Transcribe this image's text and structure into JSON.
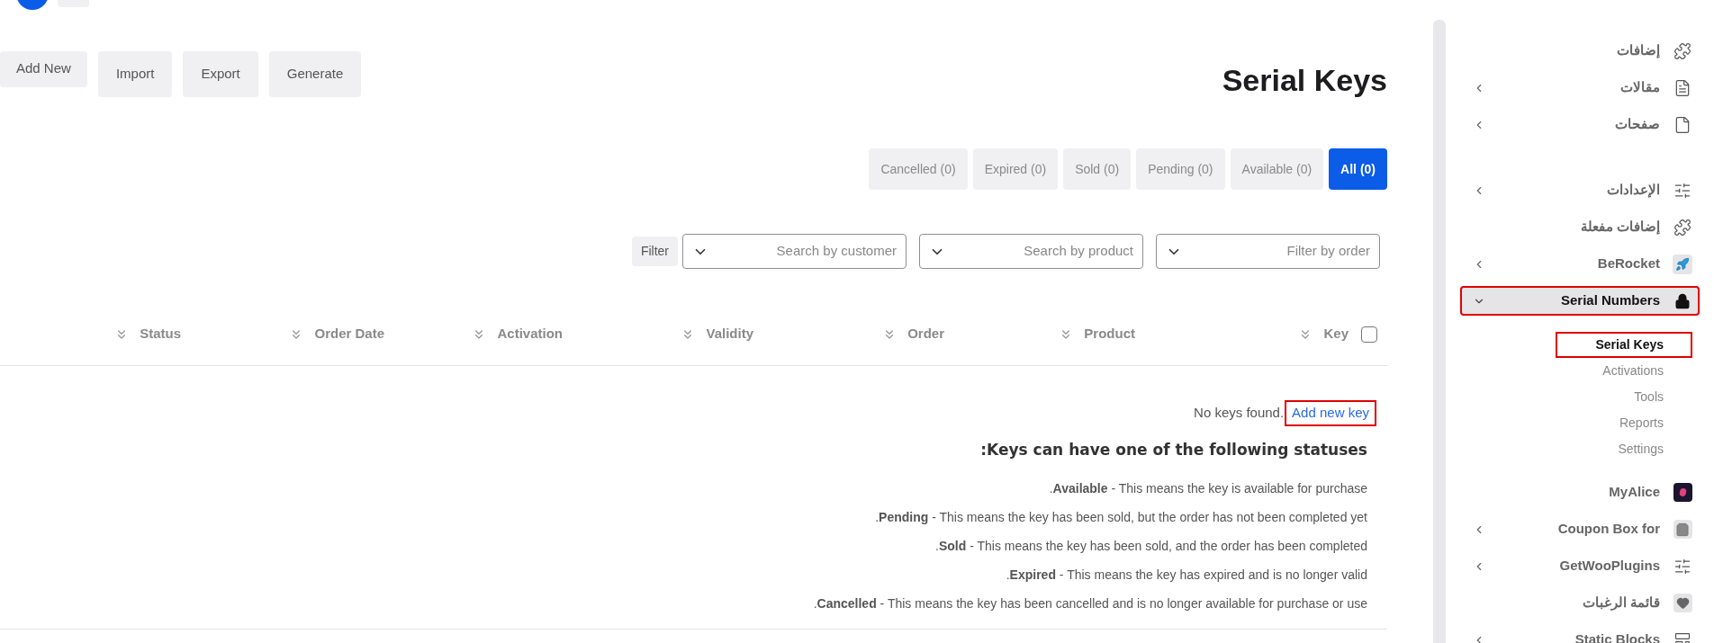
{
  "toolbar": {
    "buttons": [
      {
        "label": "Add New",
        "kind": "short"
      },
      {
        "label": "Import",
        "kind": "tall"
      },
      {
        "label": "Export",
        "kind": "tall"
      },
      {
        "label": "Generate",
        "kind": "tall"
      }
    ]
  },
  "title": "Serial Keys",
  "tabs": [
    {
      "label": "Cancelled (0)",
      "selected": false
    },
    {
      "label": "Expired (0)",
      "selected": false
    },
    {
      "label": "Sold (0)",
      "selected": false
    },
    {
      "label": "Pending (0)",
      "selected": false
    },
    {
      "label": "Available (0)",
      "selected": false
    },
    {
      "label": "All (0)",
      "selected": true
    }
  ],
  "filters": {
    "button": "Filter",
    "selects": [
      {
        "placeholder": "Search by customer"
      },
      {
        "placeholder": "Search by product"
      },
      {
        "placeholder": "Filter by order"
      }
    ]
  },
  "table": {
    "columns": [
      "Status",
      "Order Date",
      "Activation",
      "Validity",
      "Order",
      "Product",
      "Key"
    ],
    "select_all_checked": false
  },
  "empty": {
    "message": "No keys found.",
    "link": "Add new key",
    "link_annotated": true
  },
  "statuses": {
    "heading": ":Keys can have one of the following statuses",
    "lines": [
      ".**Available** - This means the key is available for purchase",
      ".**Pending** - This means the key has been sold, but the order has not been completed yet",
      ".**Sold** - This means the key has been sold, and the order has been completed",
      ".**Expired** - This means the key has expired and is no longer valid",
      ".**Cancelled** - This means the key has been cancelled and is no longer available for purchase or use"
    ]
  },
  "sidebar": {
    "groups": [
      [
        {
          "label": "إضافات",
          "submenu": false,
          "expanded": false,
          "selected": false,
          "annotated": false
        },
        {
          "label": "مقالات",
          "submenu": true,
          "expanded": false,
          "selected": false,
          "annotated": false
        },
        {
          "label": "صفحات",
          "submenu": true,
          "expanded": false,
          "selected": false,
          "annotated": false
        }
      ],
      [
        {
          "label": "الإعدادات",
          "submenu": true,
          "expanded": false,
          "selected": false,
          "annotated": false
        },
        {
          "label": "إضافات مفعلة",
          "submenu": false,
          "expanded": false,
          "selected": false,
          "annotated": false
        },
        {
          "label": "BeRocket",
          "submenu": true,
          "expanded": false,
          "selected": false,
          "annotated": false
        },
        {
          "label": "Serial Numbers",
          "submenu": true,
          "expanded": true,
          "selected": true,
          "annotated": true,
          "children": [
            {
              "label": "Serial Keys",
              "selected": true,
              "annotated": true
            },
            {
              "label": "Activations",
              "selected": false,
              "annotated": false
            },
            {
              "label": "Tools",
              "selected": false,
              "annotated": false
            },
            {
              "label": "Reports",
              "selected": false,
              "annotated": false
            },
            {
              "label": "Settings",
              "selected": false,
              "annotated": false
            }
          ]
        },
        {
          "label": "MyAlice",
          "submenu": false,
          "expanded": false,
          "selected": false,
          "annotated": false
        },
        {
          "label": "Coupon Box for",
          "submenu": true,
          "expanded": false,
          "selected": false,
          "annotated": false
        },
        {
          "label": "GetWooPlugins",
          "submenu": true,
          "expanded": false,
          "selected": false,
          "annotated": false
        },
        {
          "label": "قائمة الرغبات",
          "submenu": false,
          "expanded": false,
          "selected": false,
          "annotated": false
        },
        {
          "label": "Static Blocks",
          "submenu": true,
          "expanded": false,
          "selected": false,
          "annotated": false
        }
      ]
    ]
  }
}
